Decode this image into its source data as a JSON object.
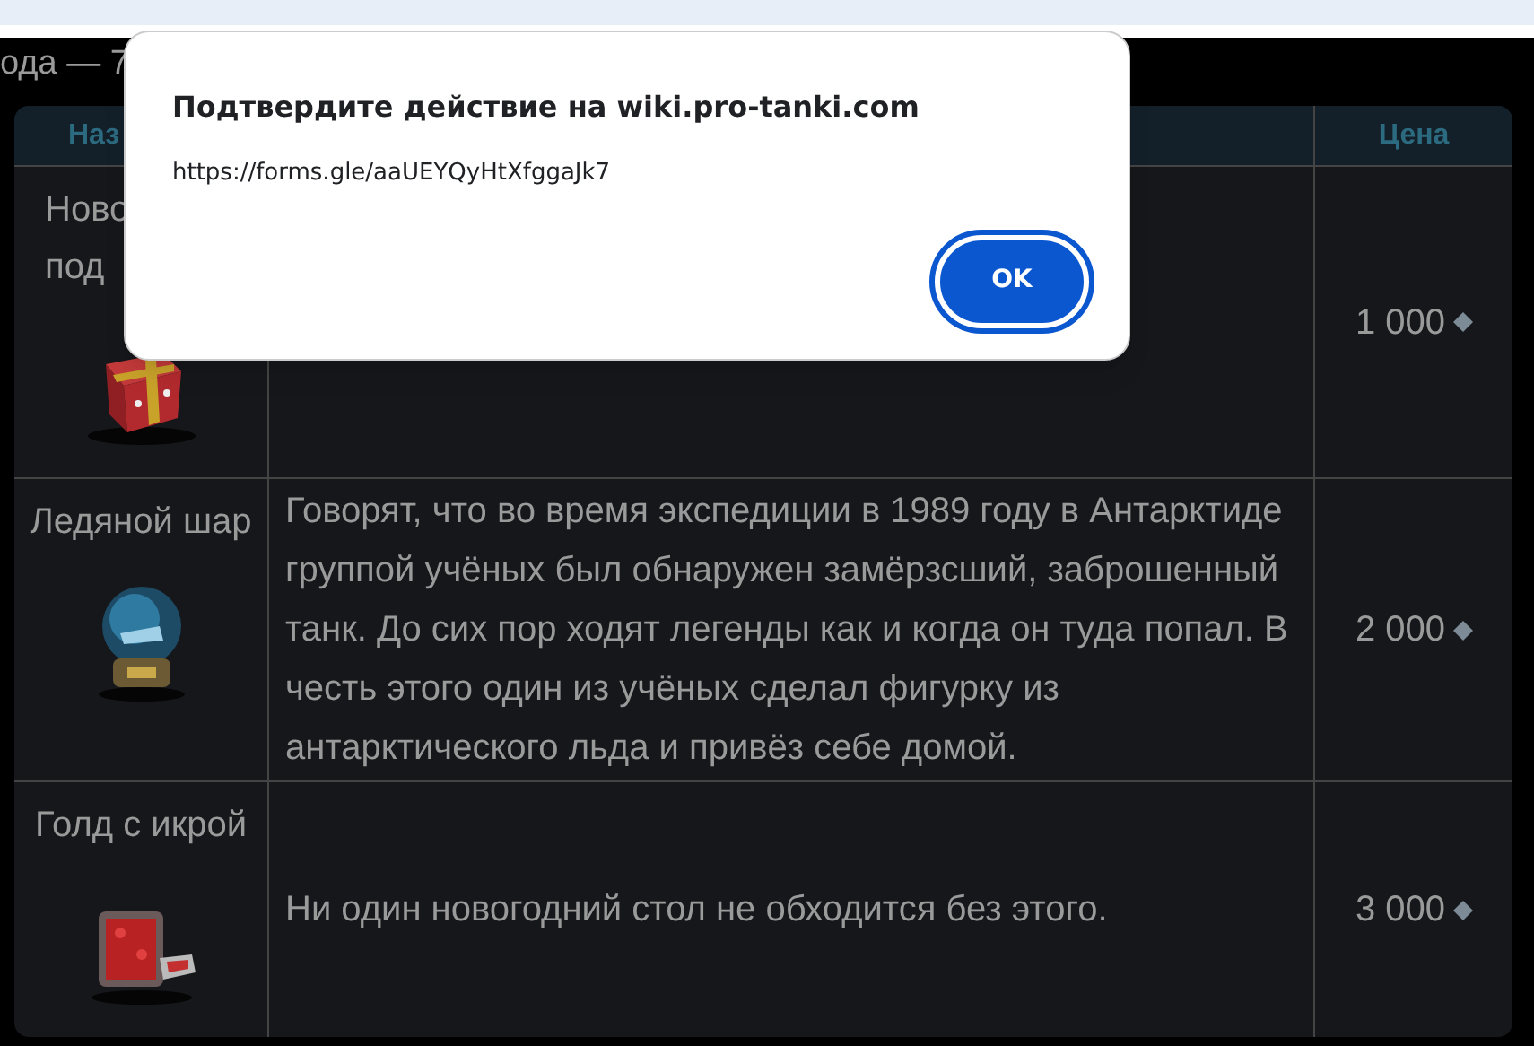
{
  "page": {
    "heading_fragment": "ода — 7"
  },
  "table": {
    "header": {
      "name": "Наз",
      "price": "Цена"
    },
    "rows": [
      {
        "name": "Ново\nпод",
        "price": "1 000"
      },
      {
        "name": "Ледяной шар",
        "description": "Говорят, что во время экспедиции в 1989 году в Антарктиде группой учёных был обнаружен замёрзсший, заброшенный танк. До сих пор ходят легенды как и когда он туда попал. В честь этого один из учёных сделал фигурку из антарктического льда и привёз себе домой.",
        "price": "2 000"
      },
      {
        "name": "Голд с икрой",
        "description": "Ни один новогодний стол не обходится без этого.",
        "price": "3 000"
      }
    ]
  },
  "dialog": {
    "title": "Подтвердите действие на wiki.pro-tanki.com",
    "message": "https://forms.gle/aaUEYQyHtXfggaJk7",
    "button": "OK"
  }
}
